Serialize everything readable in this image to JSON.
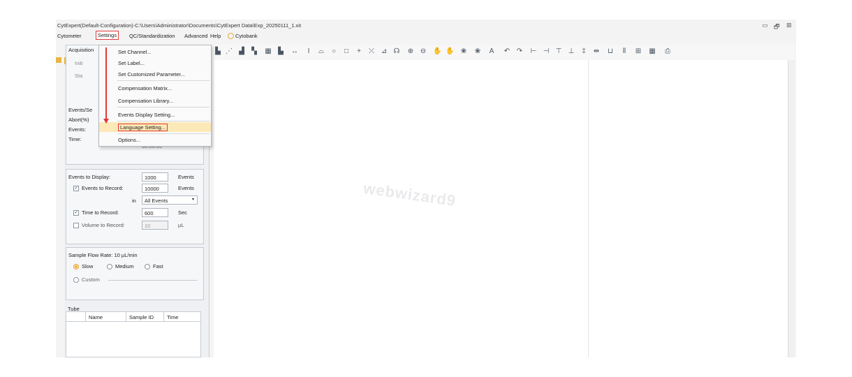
{
  "window": {
    "title": "CytExpert(Default-Configuration)-C:\\Users\\Administrator\\Documents\\CytExpert Data\\Exp_20250111_1.xit",
    "controls": [
      "▭",
      "🗗",
      "⊠"
    ]
  },
  "menubar": {
    "items": [
      "Cytometer",
      "Settings",
      "QC/Standardization",
      "Advanced",
      "Help",
      "Cytobank"
    ],
    "active": "Settings"
  },
  "settings_menu": {
    "items": [
      "Set Channel...",
      "Set Label...",
      "Set Customized Parameter...",
      "Compensation Matrix...",
      "Compensation Library...",
      "Events Display Setting...",
      "Language Setting...",
      "Options..."
    ],
    "selected": "Language Setting..."
  },
  "acquisition": {
    "header": "Acquisition",
    "initialize": "Initi",
    "start": "Sta",
    "events_per_sec_label": "Events/Se",
    "abort_label": "Abort(%)",
    "events_label": "Events:",
    "time_label": "Time:",
    "time_value": "00:00:00"
  },
  "settings": {
    "events_to_display_label": "Events to Display:",
    "events_to_display_value": "1000",
    "events_unit": "Events",
    "events_to_record_label": "Events to Record:",
    "events_to_record_value": "10000",
    "in_label": "in",
    "in_value": "All Events",
    "time_to_record_label": "Time to Record:",
    "time_to_record_value": "600",
    "time_unit": "Sec",
    "volume_to_record_label": "Volume to Record:",
    "volume_to_record_value": "10",
    "volume_unit": "μL",
    "sample_flow_rate_label": "Sample Flow Rate:  10 μL/min",
    "slow": "Slow",
    "medium": "Medium",
    "fast": "Fast",
    "custom": "Custom"
  },
  "tube": {
    "header": "Tube",
    "columns": [
      "Name",
      "Sample ID",
      "Time"
    ]
  },
  "canvas": {
    "watermark": "webwizard9"
  },
  "colors": {
    "highlight_red": "#e03a3a",
    "menu_selected": "#fde9b7"
  }
}
